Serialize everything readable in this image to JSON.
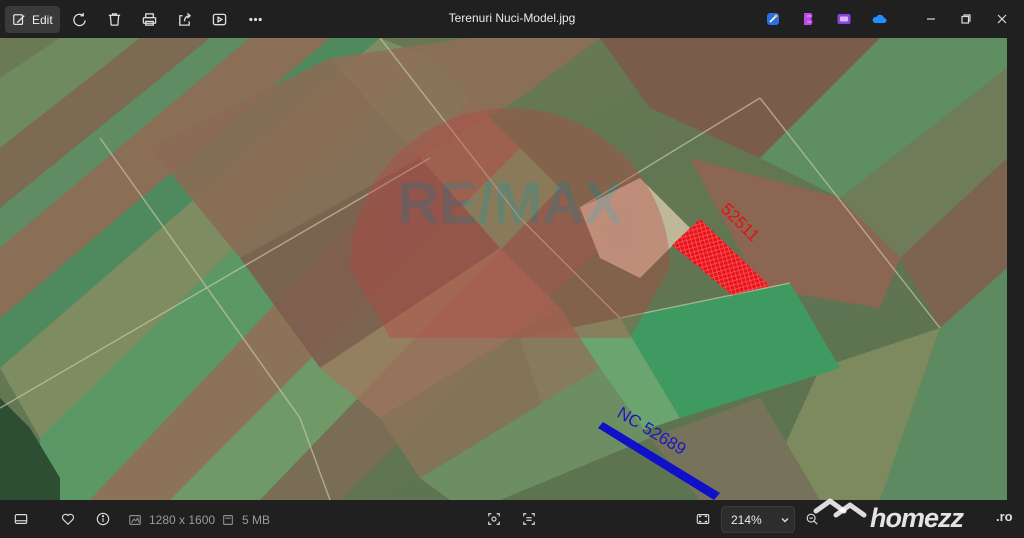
{
  "window": {
    "title": "Terenuri Nuci-Model.jpg"
  },
  "toolbar": {
    "edit_label": "Edit",
    "icons": [
      "edit-icon",
      "rotate-icon",
      "delete-icon",
      "print-icon",
      "share-icon",
      "slideshow-icon",
      "more-icon"
    ]
  },
  "apps": [
    "designer-icon",
    "clipchamp-icon",
    "photos-icon",
    "onedrive-icon"
  ],
  "image": {
    "parcel_label": "52511",
    "road_label": "NC 52689",
    "logo_text": "RE/MAX",
    "parcel_color": "#e8141c",
    "road_color": "#1010c8"
  },
  "status": {
    "dimensions": "1280 x 1600",
    "file_size": "5 MB",
    "zoom": "214%"
  },
  "watermark": {
    "text": "homezz",
    "suffix": ".ro"
  }
}
